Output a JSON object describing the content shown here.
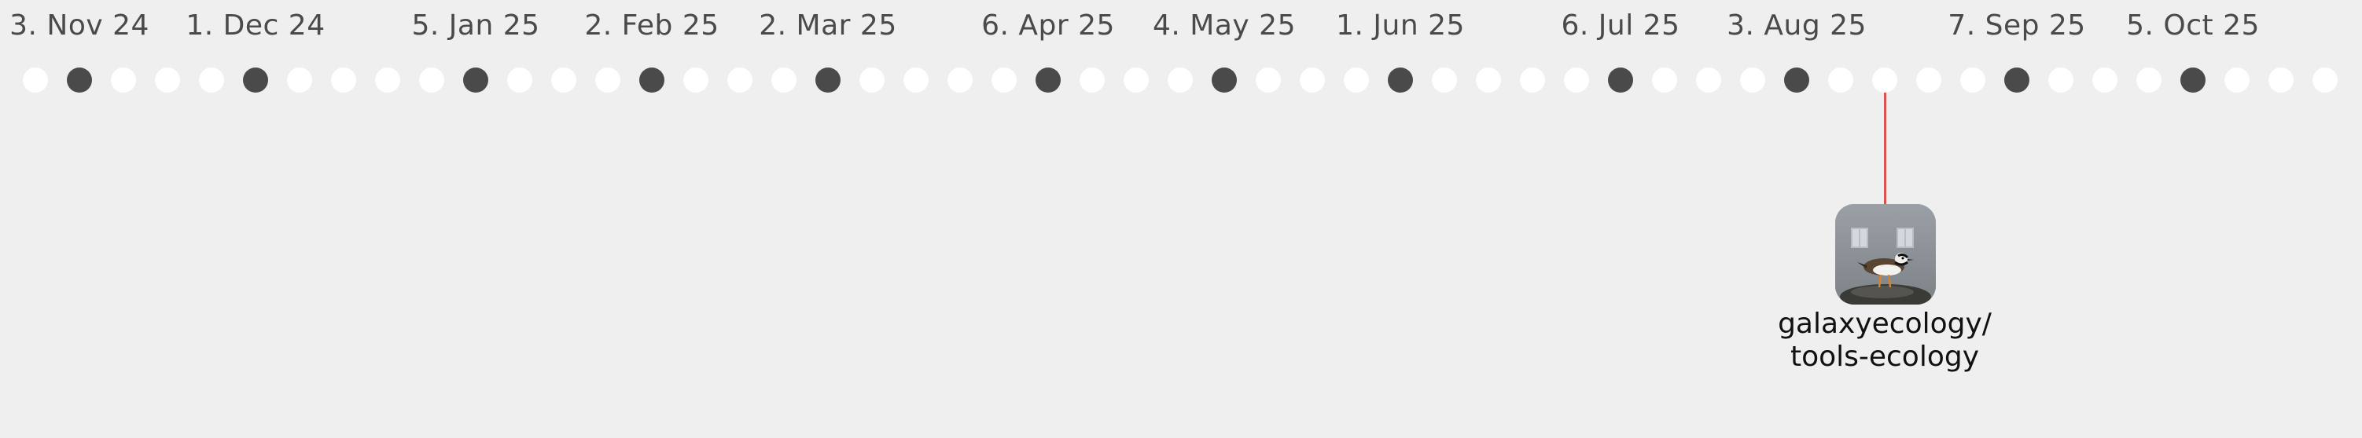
{
  "timeline": {
    "tick_labels": [
      "3. Nov 24",
      "1. Dec 24",
      "5. Jan 25",
      "2. Feb 25",
      "2. Mar 25",
      "6. Apr 25",
      "4. May 25",
      "1. Jun 25",
      "6. Jul 25",
      "3. Aug 25",
      "7. Sep 25",
      "5. Oct 25"
    ],
    "colors": {
      "background": "#efefef",
      "empty_dot": "#ffffff",
      "filled_dot": "#4a4a4a",
      "connector": "#d9534f",
      "label_text": "#4a4a4a"
    }
  },
  "event": {
    "repo_line1": "galaxyecology/",
    "repo_line2": "tools-ecology",
    "avatar_icon": "bird-photo-avatar"
  }
}
